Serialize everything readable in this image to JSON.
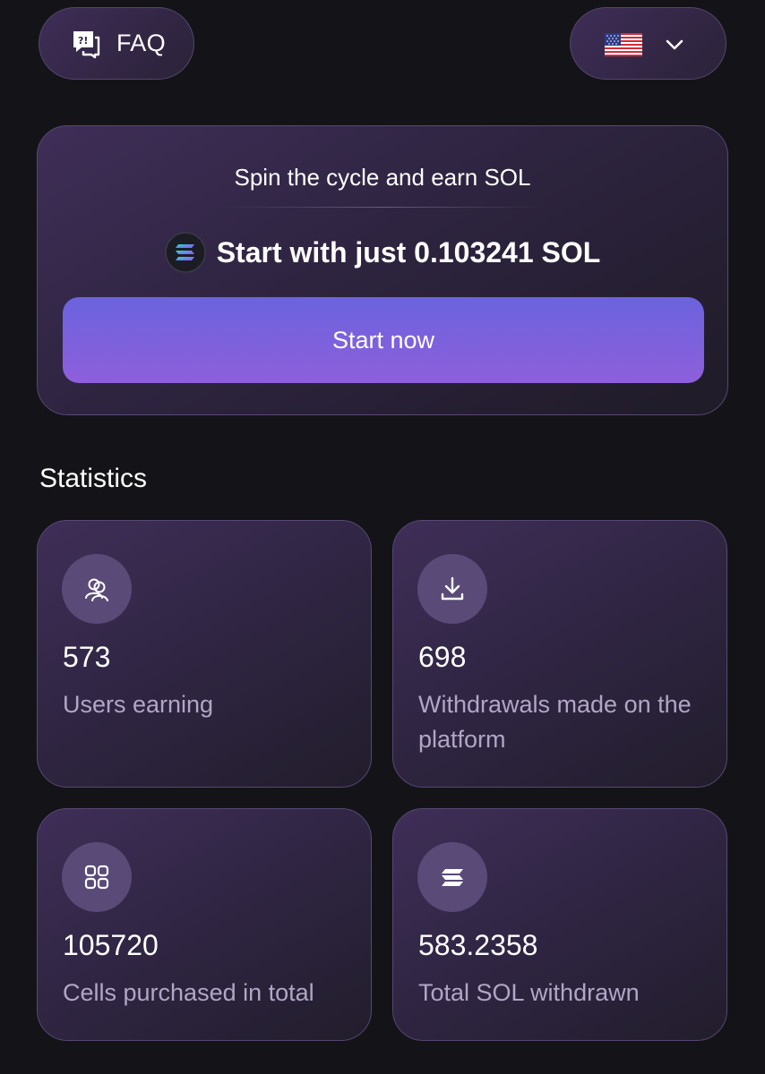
{
  "header": {
    "faq_label": "FAQ",
    "faq_icon": "faq-chat-icon",
    "language_icon": "us-flag-icon",
    "dropdown_icon": "chevron-down-icon"
  },
  "hero": {
    "title": "Spin the cycle and earn SOL",
    "price_text": "Start with just 0.103241 SOL",
    "price_icon": "solana-logo-icon",
    "cta_label": "Start now",
    "cta_gradient": [
      "#6b63dd",
      "#8e5fdc"
    ]
  },
  "statistics": {
    "heading": "Statistics",
    "cards": [
      {
        "icon": "users-icon",
        "value": "573",
        "label": "Users earning"
      },
      {
        "icon": "download-icon",
        "value": "698",
        "label": "Withdrawals made on the platform"
      },
      {
        "icon": "grid-icon",
        "value": "105720",
        "label": "Cells purchased in total"
      },
      {
        "icon": "solana-icon",
        "value": "583.2358",
        "label": "Total SOL withdrawn"
      }
    ]
  },
  "colors": {
    "background": "#141418",
    "card_border": "#574872",
    "icon_circle": "#5a4a78",
    "muted_text": "#b2a6c6"
  }
}
